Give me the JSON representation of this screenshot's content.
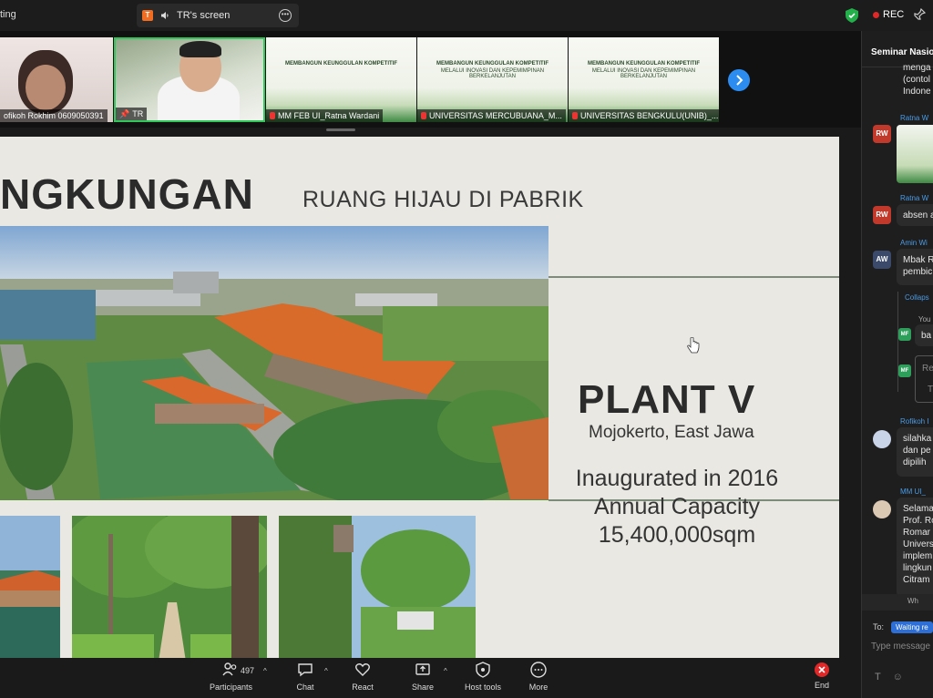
{
  "window": {
    "left_title": "ting",
    "screen_tab_label": "TR's screen",
    "tab_badge": "T",
    "rec_label": "REC",
    "colors": {
      "accent": "#2d8cf0",
      "rec": "#e02828",
      "active_speaker": "#30c85a"
    }
  },
  "participants_strip": [
    {
      "label": "ofikoh Rokhim 0609050391"
    },
    {
      "label": "TR"
    },
    {
      "label": "MM FEB UI_Ratna Wardani"
    },
    {
      "label": "UNIVERSITAS MERCUBUANA_M..."
    },
    {
      "label": "UNIVERSITAS BENGKULU(UNIB)_..."
    }
  ],
  "banners": {
    "b1_title": "MEMBANGUN KEUNGGULAN KOMPETITIF",
    "b2_title": "MEMBANGUN KEUNGGULAN KOMPETITIF",
    "b3_title": "MEMBANGUN KEUNGGULAN KOMPETITIF",
    "b2_sub": "MELALUI INOVASI DAN KEPEMIMPINAN BERKELANJUTAN",
    "b3_sub": "MELALUI INOVASI DAN KEPEMIMPINAN BERKELANJUTAN"
  },
  "slide": {
    "title": "NGKUNGAN",
    "subtitle": "RUANG HIJAU DI PABRIK",
    "plant_name": "PLANT V",
    "location": "Mojokerto, East Jawa",
    "info_line1": "Inaugurated in 2016",
    "info_line2": "Annual Capacity",
    "info_line3": "15,400,000sqm"
  },
  "toolbar": {
    "participants_count": "497",
    "participants_label": "Participants",
    "chat_label": "Chat",
    "react_label": "React",
    "share_label": "Share",
    "host_tools_label": "Host tools",
    "more_label": "More",
    "end_label": "End"
  },
  "chat": {
    "header": "Seminar Nasion",
    "top_lines": [
      "menga",
      "(contol",
      "Indone"
    ],
    "m1_sender": "Ratna W",
    "m1_avatar": "RW",
    "m2_sender": "Ratna W",
    "m2_avatar": "RW",
    "m2_text": "absen a",
    "m3_sender": "Amin Wi",
    "m3_avatar": "AW",
    "m3_lines": [
      "Mbak R",
      "pembic"
    ],
    "collapse": "Collaps",
    "reply_you": "You",
    "reply_text": "ba",
    "reply_avatar": "MF",
    "reply2_avatar": "MF",
    "reply2_placeholder": "Re",
    "reply2_line2": "T",
    "m4_sender": "Rofikoh I",
    "m4_lines": [
      "silahka",
      "dan pe",
      "dipilih"
    ],
    "m5_sender": "MM UI_",
    "m5_lines": [
      "Selama",
      "Prof. Ro",
      "Romar",
      "Univers",
      "implem",
      "lingkun",
      "Citram"
    ],
    "who_label": "Wh",
    "to_label": "To:",
    "waiting_label": "Waiting re",
    "type_placeholder": "Type message"
  }
}
